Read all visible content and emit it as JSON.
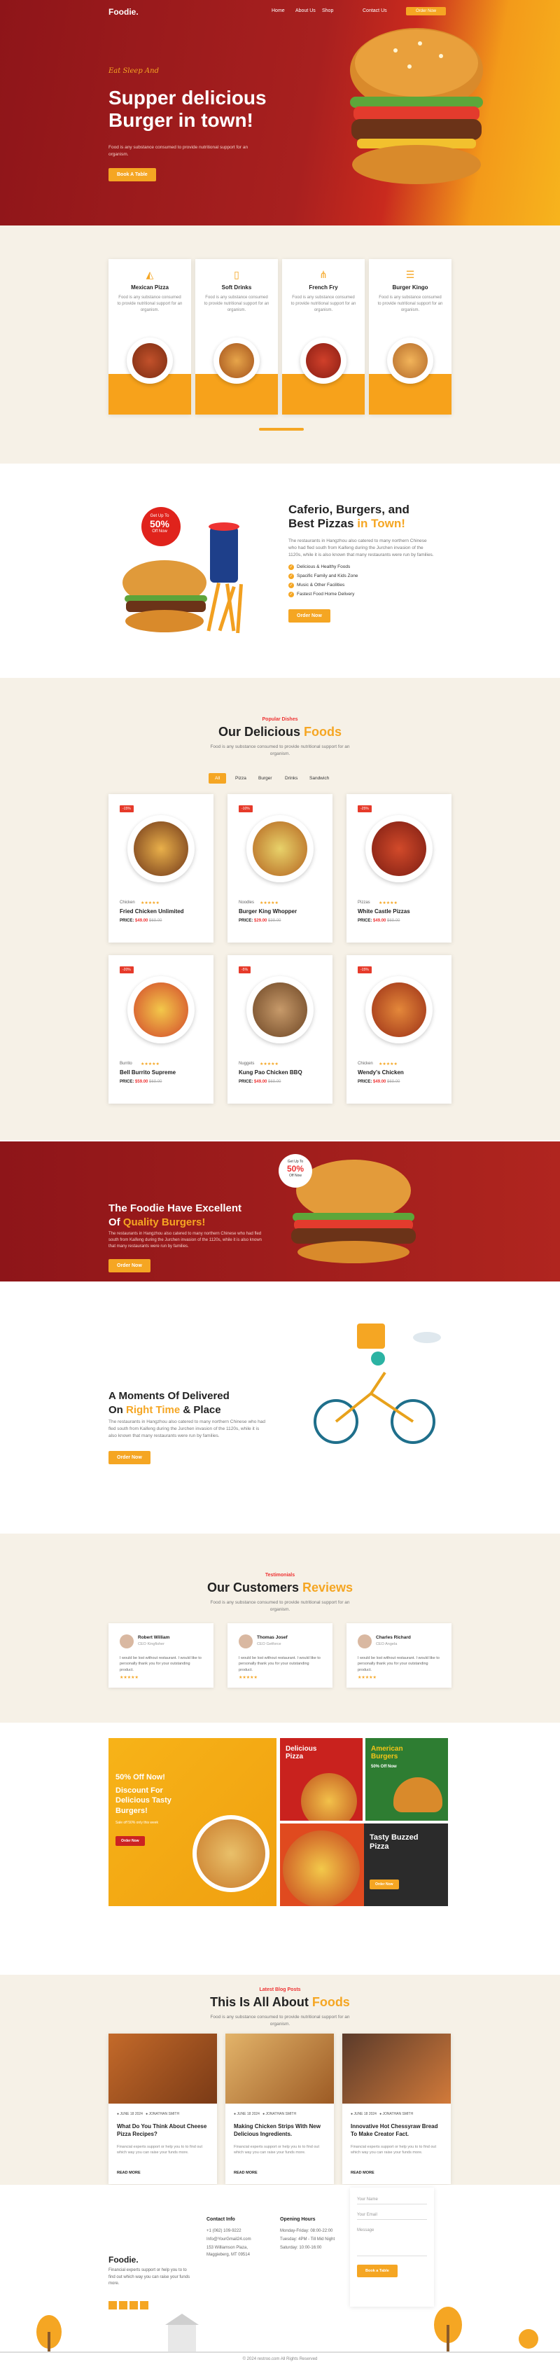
{
  "nav": {
    "logo": "Foodie.",
    "items": [
      "Home",
      "About Us",
      "Shop",
      "Contact Us"
    ],
    "order": "Order Now"
  },
  "hero": {
    "kicker": "Eat Sleep And",
    "title": "Supper delicious Burger in town!",
    "sub": "Food is any substance consumed to provide nutritional support for an organism.",
    "button": "Book A Table"
  },
  "categories": [
    {
      "name": "Mexican Pizza",
      "desc": "Food is any substance consumed to provide nutritional support for an organism."
    },
    {
      "name": "Soft Drinks",
      "desc": "Food is any substance consumed to provide nutritional support for an organism."
    },
    {
      "name": "French Fry",
      "desc": "Food is any substance consumed to provide nutritional support for an organism."
    },
    {
      "name": "Burger Kingo",
      "desc": "Food is any substance consumed to provide nutritional support for an organism."
    }
  ],
  "about": {
    "badge_top": "Get Up To",
    "badge_pct": "50%",
    "badge_bot": "Off Now",
    "title1": "Caferio, Burgers, and",
    "title2": "Best Pizzas ",
    "title_accent": "in Town!",
    "text": "The restaurants in Hangzhou also catered to many northern Chinese who had fled south from Kaifeng during the Jurchen invasion of the 1120s, while it is also known that many restaurants were run by families.",
    "features": [
      "Delicious & Healthy Foods",
      "Spacific Family and Kids Zone",
      "Music & Other Facilities",
      "Fastest Food Home Delivery"
    ],
    "button": "Order Now"
  },
  "menu": {
    "kicker": "Popular Dishes",
    "title": "Our Delicious ",
    "title_accent": "Foods",
    "sub": "Food is any substance consumed to provide nutritional support for an organism.",
    "tabs": [
      "All",
      "Pizza",
      "Burger",
      "Drinks",
      "Sandwich"
    ],
    "items": [
      {
        "badge": "-15%",
        "cat": "Chicken",
        "name": "Fried Chicken Unlimited",
        "label": "PRICE:",
        "price": "$49.00",
        "old": "$69.00"
      },
      {
        "badge": "-10%",
        "cat": "Noodles",
        "name": "Burger King Whopper",
        "label": "PRICE:",
        "price": "$29.00",
        "old": "$39.00"
      },
      {
        "badge": "-25%",
        "cat": "Pizzas",
        "name": "White Castle Pizzas",
        "label": "PRICE:",
        "price": "$49.00",
        "old": "$69.00"
      },
      {
        "badge": "-20%",
        "cat": "Burrito",
        "name": "Bell Burrito Supreme",
        "label": "PRICE:",
        "price": "$59.00",
        "old": "$69.00"
      },
      {
        "badge": "-5%",
        "cat": "Nuggets",
        "name": "Kung Pao Chicken BBQ",
        "label": "PRICE:",
        "price": "$49.00",
        "old": "$69.00"
      },
      {
        "badge": "-15%",
        "cat": "Chicken",
        "name": "Wendy's Chicken",
        "label": "PRICE:",
        "price": "$49.00",
        "old": "$69.00"
      }
    ],
    "stars": "★★★★★"
  },
  "quality": {
    "title1": "The Foodie Have Excellent",
    "title2": "Of ",
    "title_accent": "Quality Burgers!",
    "text": "The restaurants in Hangzhou also catered to many northern Chinese who had fled south from Kaifeng during the Jurchen invasion of the 1120s, while it is also known that many restaurants were run by families.",
    "button": "Order Now",
    "badge_top": "Get Up To",
    "badge_pct": "50%",
    "badge_bot": "Off Now"
  },
  "delivery": {
    "title1": "A Moments Of Delivered",
    "title2": "On ",
    "title_accent": "Right Time",
    "title3": " & Place",
    "text": "The restaurants in Hangzhou also catered to many northern Chinese who had fled south from Kaifeng during the Jurchen invasion of the 1120s, while it is also known that many restaurants were run by families.",
    "button": "Order Now"
  },
  "testimonials": {
    "kicker": "Testimonials",
    "title": "Our Customers ",
    "title_accent": "Reviews",
    "sub": "Food is any substance consumed to provide nutritional support for an organism.",
    "items": [
      {
        "name": "Robert William",
        "role": "CEO Kingfisher",
        "quote": "I would be lost without restaurant. I would like to personally thank you for your outstanding product."
      },
      {
        "name": "Thomas Josef",
        "role": "CEO Getforce",
        "quote": "I would be lost without restaurant. I would like to personally thank you for your outstanding product."
      },
      {
        "name": "Charles Richard",
        "role": "CEO Angela",
        "quote": "I would be lost without restaurant. I would like to personally thank you for your outstanding product."
      }
    ],
    "stars": "★★★★★"
  },
  "promos": {
    "p1a": "50% Off Now!",
    "p1b": "Discount For Delicious Tasty Burgers!",
    "p1c": "Sale off 50% only this week",
    "p2": "Delicious Pizza",
    "p3": "American Burgers",
    "p3b": "50% Off Now",
    "p4": "Tasty Buzzed Pizza",
    "order": "Order Now"
  },
  "blog": {
    "kicker": "Latest Blog Posts",
    "title": "This Is All About ",
    "title_accent": "Foods",
    "sub": "Food is any substance consumed to provide nutritional support for an organism.",
    "items": [
      {
        "date": "JUNE 18 2024",
        "author": "JONATHAN SMITH",
        "title": "What Do You Think About Cheese Pizza Recipes?",
        "desc": "Financial experts support or help you to to find out which way you can raise your funds more.",
        "more": "READ MORE"
      },
      {
        "date": "JUNE 18 2024",
        "author": "JONATHAN SMITH",
        "title": "Making Chicken Strips With New Delicious Ingredients.",
        "desc": "Financial experts support or help you to to find out which way you can raise your funds more.",
        "more": "READ MORE"
      },
      {
        "date": "JUNE 18 2024",
        "author": "JONATHAN SMITH",
        "title": "Innovative Hot Chessyraw Bread To Make Creator Fact.",
        "desc": "Financial experts support or help you to to find out which way you can raise your funds more.",
        "more": "READ MORE"
      }
    ]
  },
  "footer": {
    "logo": "Foodie.",
    "about": "Financial experts support or help you to to find out which way you can raise your funds more.",
    "contact_h": "Contact Info",
    "phone": "+1 (062) 109-9222",
    "email": "Info@YourGmail24.com",
    "address": "153 Williamson Plaza, Maggieberg, MT 09514",
    "hours_h": "Opening Hours",
    "hours1": "Monday-Friday: 08:00-22:00",
    "hours2": "Tuesday: 4PM - Till Mid Night",
    "hours3": "Saturday: 10:00-16:00",
    "form_name": "Your Name",
    "form_email": "Your Email",
    "form_msg": "Message",
    "form_btn": "Book a Table",
    "copyright": "© 2024 restroo.com All Rights Reserved"
  },
  "colors": {
    "brand_red": "#9e1b1f",
    "accent": "#f5a623"
  }
}
